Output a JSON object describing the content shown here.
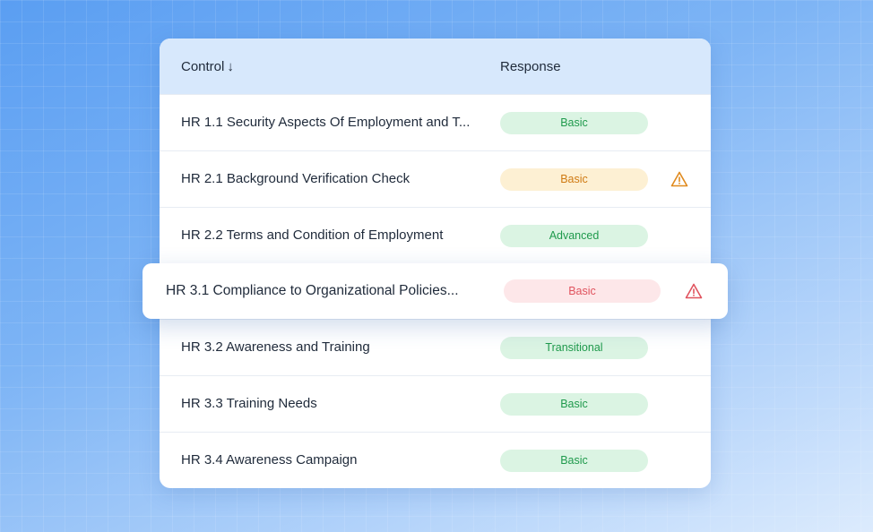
{
  "table": {
    "header": {
      "control_label": "Control",
      "sort_arrow": "↓",
      "response_label": "Response"
    },
    "rows": [
      {
        "control": "HR 1.1 Security Aspects Of Employment and T...",
        "response": "Basic",
        "status": "green",
        "warning": false
      },
      {
        "control": "HR 2.1 Background Verification Check",
        "response": "Basic",
        "status": "yellow",
        "warning": true
      },
      {
        "control": "HR 2.2 Terms and Condition of Employment",
        "response": "Advanced",
        "status": "green",
        "warning": false
      },
      {
        "control": "HR 3.1 Compliance to Organizational Policies...",
        "response": "Basic",
        "status": "red",
        "warning": true
      },
      {
        "control": "HR 3.2 Awareness and Training",
        "response": "Transitional",
        "status": "green",
        "warning": false
      },
      {
        "control": "HR 3.3 Training Needs",
        "response": "Basic",
        "status": "green",
        "warning": false
      },
      {
        "control": "HR 3.4 Awareness Campaign",
        "response": "Basic",
        "status": "green",
        "warning": false
      }
    ]
  },
  "colors": {
    "badge_green_bg": "#dbf4e3",
    "badge_green_text": "#1f9a4c",
    "badge_yellow_bg": "#fdf0d3",
    "badge_yellow_text": "#cf7a12",
    "badge_red_bg": "#fde7e9",
    "badge_red_text": "#e0535e",
    "warning_yellow": "#e08a1e",
    "warning_red": "#e0535e"
  },
  "icons": {
    "sort": "arrow-down-icon",
    "warning": "warning-triangle-icon"
  }
}
